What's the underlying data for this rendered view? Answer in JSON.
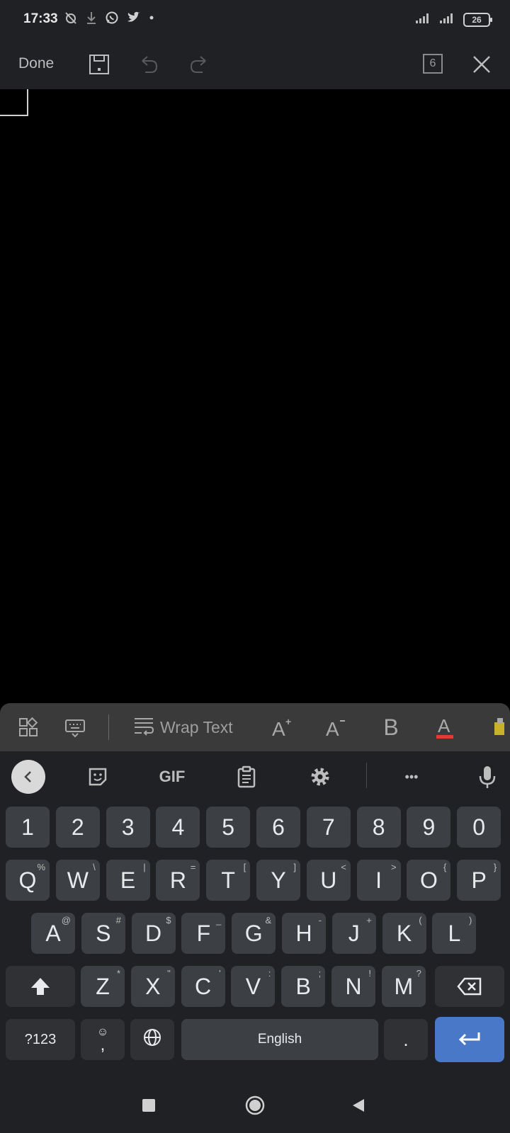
{
  "status_bar": {
    "time": "17:33",
    "battery": "26",
    "icons": [
      "alarm-off-icon",
      "download-icon",
      "whatsapp-icon",
      "twitter-icon",
      "dot-icon"
    ],
    "right_icons": [
      "signal-icon",
      "signal-icon",
      "battery-icon"
    ]
  },
  "toolbar": {
    "done_label": "Done",
    "sheet_count": "6"
  },
  "format_bar": {
    "wrap_text_label": "Wrap Text",
    "bold_label": "B",
    "font_color": "#e53935",
    "icons": [
      "layout-icon",
      "keyboard-toggle-icon",
      "wrap-text-icon",
      "font-size-increase-icon",
      "font-size-decrease-icon",
      "bold-icon",
      "font-color-icon",
      "highlighter-icon"
    ]
  },
  "keyboard": {
    "tool_icons": [
      "back-icon",
      "sticker-icon",
      "gif-icon",
      "clipboard-icon",
      "settings-icon",
      "more-icon",
      "mic-icon"
    ],
    "gif_label": "GIF",
    "more_label": "•••",
    "number_row": [
      "1",
      "2",
      "3",
      "4",
      "5",
      "6",
      "7",
      "8",
      "9",
      "0"
    ],
    "row1": [
      {
        "key": "Q",
        "hint": "%"
      },
      {
        "key": "W",
        "hint": "\\"
      },
      {
        "key": "E",
        "hint": "|"
      },
      {
        "key": "R",
        "hint": "="
      },
      {
        "key": "T",
        "hint": "["
      },
      {
        "key": "Y",
        "hint": "]"
      },
      {
        "key": "U",
        "hint": "<"
      },
      {
        "key": "I",
        "hint": ">"
      },
      {
        "key": "O",
        "hint": "{"
      },
      {
        "key": "P",
        "hint": "}"
      }
    ],
    "row2": [
      {
        "key": "A",
        "hint": "@"
      },
      {
        "key": "S",
        "hint": "#"
      },
      {
        "key": "D",
        "hint": "$"
      },
      {
        "key": "F",
        "hint": "_"
      },
      {
        "key": "G",
        "hint": "&"
      },
      {
        "key": "H",
        "hint": "-"
      },
      {
        "key": "J",
        "hint": "+"
      },
      {
        "key": "K",
        "hint": "("
      },
      {
        "key": "L",
        "hint": ")"
      }
    ],
    "row3": [
      {
        "key": "Z",
        "hint": "*"
      },
      {
        "key": "X",
        "hint": "\""
      },
      {
        "key": "C",
        "hint": "'"
      },
      {
        "key": "V",
        "hint": ":"
      },
      {
        "key": "B",
        "hint": ";"
      },
      {
        "key": "N",
        "hint": "!"
      },
      {
        "key": "M",
        "hint": "?"
      }
    ],
    "symbols_label": "?123",
    "comma_label": ",",
    "space_label": "English",
    "period_label": ".",
    "enter_color": "#4a78c8"
  },
  "nav_bar": {
    "icons": [
      "recents-icon",
      "home-icon",
      "back-icon"
    ]
  }
}
